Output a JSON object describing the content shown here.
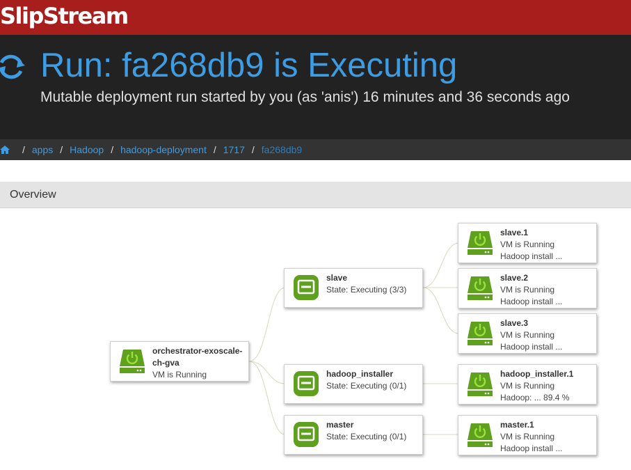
{
  "brand": {
    "name": "SlipStream"
  },
  "header": {
    "title": "Run: fa268db9 is Executing",
    "subtitle": "Mutable deployment run started by you (as 'anis') 16 minutes and 36 seconds ago",
    "status_icon": "refresh-icon"
  },
  "breadcrumb": {
    "home_icon": "home-icon",
    "items": [
      "apps",
      "Hadoop",
      "hadoop-deployment",
      "1717"
    ],
    "current": "fa268db9"
  },
  "overview": {
    "title": "Overview"
  },
  "graph": {
    "orchestrator": {
      "title": "orchestrator-exoscale-ch-gva",
      "status": "VM is Running"
    },
    "groups": [
      {
        "title": "slave",
        "state": "State: Executing (3/3)"
      },
      {
        "title": "hadoop_installer",
        "state": "State: Executing (0/1)"
      },
      {
        "title": "master",
        "state": "State: Executing (0/1)"
      }
    ],
    "vms": [
      {
        "title": "slave.1",
        "status": "VM is Running",
        "detail": "Hadoop install ..."
      },
      {
        "title": "slave.2",
        "status": "VM is Running",
        "detail": "Hadoop install ..."
      },
      {
        "title": "slave.3",
        "status": "VM is Running",
        "detail": "Hadoop install ..."
      },
      {
        "title": "hadoop_installer.1",
        "status": "VM is Running",
        "detail": "Hadoop: ... 89.4 %"
      },
      {
        "title": "master.1",
        "status": "VM is Running",
        "detail": "Hadoop install ..."
      }
    ]
  },
  "colors": {
    "brand_bar": "#a81e1c",
    "header_bg": "#222222",
    "accent": "#3d9ce2",
    "node_green": "#5fa01e",
    "power_green": "#9be23a"
  }
}
